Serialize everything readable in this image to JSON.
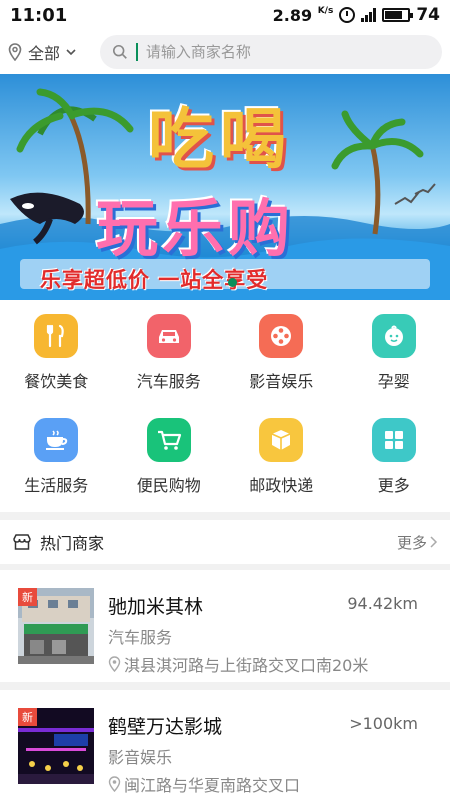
{
  "status": {
    "time": "11:01",
    "speed": "2.89",
    "speed_unit": "K/s",
    "battery": "74"
  },
  "header": {
    "location_label": "全部",
    "search_placeholder": "请输入商家名称"
  },
  "banner": {
    "line1": "吃喝",
    "line2": "玩乐购",
    "slogan": "乐享超低价 一站全享受"
  },
  "categories": [
    {
      "label": "餐饮美食",
      "icon": "utensils-icon",
      "color": "#f7b731"
    },
    {
      "label": "汽车服务",
      "icon": "car-icon",
      "color": "#f2636a"
    },
    {
      "label": "影音娱乐",
      "icon": "film-reel-icon",
      "color": "#f56c55"
    },
    {
      "label": "孕婴",
      "icon": "baby-icon",
      "color": "#38cbb7"
    },
    {
      "label": "生活服务",
      "icon": "coffee-cup-icon",
      "color": "#5aa0f5"
    },
    {
      "label": "便民购物",
      "icon": "shopping-cart-icon",
      "color": "#19c37a"
    },
    {
      "label": "邮政快递",
      "icon": "package-icon",
      "color": "#f8c63e"
    },
    {
      "label": "更多",
      "icon": "grid-icon",
      "color": "#3ec8c8"
    }
  ],
  "hot": {
    "title": "热门商家",
    "more": "更多"
  },
  "merchants": [
    {
      "badge": "新",
      "name": "驰加米其林",
      "distance": "94.42km",
      "category": "汽车服务",
      "address": "淇县淇河路与上街路交叉口南20米"
    },
    {
      "badge": "新",
      "name": "鹤壁万达影城",
      "distance": ">100km",
      "category": "影音娱乐",
      "address": "闽江路与华夏南路交叉口"
    }
  ],
  "colors": {
    "accent": "#0a8f5a",
    "badge": "#e84b3c"
  }
}
